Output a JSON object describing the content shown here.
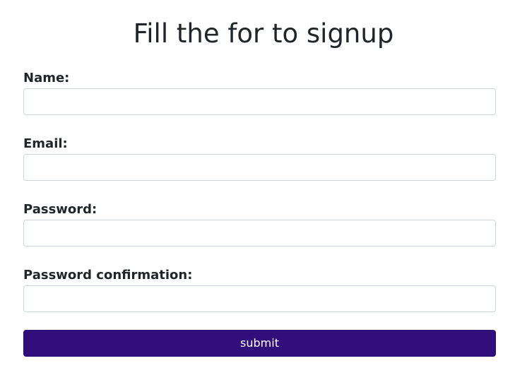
{
  "page": {
    "title": "Fill the for to signup"
  },
  "form": {
    "fields": [
      {
        "label": "Name:",
        "value": "",
        "placeholder": ""
      },
      {
        "label": "Email:",
        "value": "",
        "placeholder": ""
      },
      {
        "label": "Password:",
        "value": "",
        "placeholder": ""
      },
      {
        "label": "Password confirmation:",
        "value": "",
        "placeholder": ""
      }
    ],
    "submit_label": "submit"
  },
  "colors": {
    "text": "#212529",
    "input_border": "#ced4da",
    "submit_background": "#320d7c",
    "submit_text": "#ffffff"
  }
}
